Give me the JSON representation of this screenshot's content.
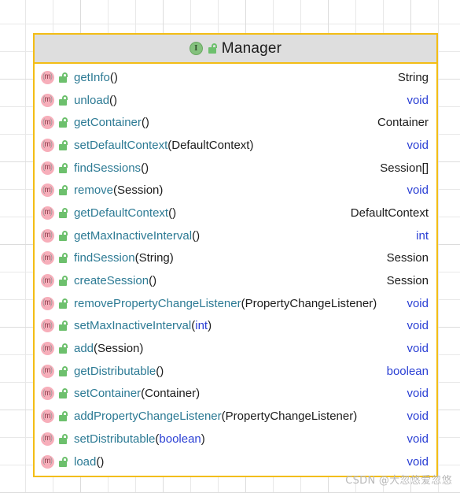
{
  "diagram": {
    "type": "uml-class-diagram",
    "background": "graph-paper-grid",
    "grid_color": "#e8e8e8",
    "box": {
      "border_color": "#f3bd15",
      "header_background": "#dedede",
      "body_background": "#ffffff"
    }
  },
  "class_box": {
    "stereotype_icon": "interface-icon",
    "stereotype_letter": "I",
    "visibility_icon": "public-unlocked-padlock-icon",
    "name": "Manager",
    "members": [
      {
        "icon": "method-icon",
        "visibility_icon": "public-unlocked-padlock-icon",
        "name": "getInfo",
        "params": "",
        "param_primitive": false,
        "return_type": "String",
        "return_primitive": false
      },
      {
        "icon": "method-icon",
        "visibility_icon": "public-unlocked-padlock-icon",
        "name": "unload",
        "params": "",
        "param_primitive": false,
        "return_type": "void",
        "return_primitive": true
      },
      {
        "icon": "method-icon",
        "visibility_icon": "public-unlocked-padlock-icon",
        "name": "getContainer",
        "params": "",
        "param_primitive": false,
        "return_type": "Container",
        "return_primitive": false
      },
      {
        "icon": "method-icon",
        "visibility_icon": "public-unlocked-padlock-icon",
        "name": "setDefaultContext",
        "params": "DefaultContext",
        "param_primitive": false,
        "return_type": "void",
        "return_primitive": true
      },
      {
        "icon": "method-icon",
        "visibility_icon": "public-unlocked-padlock-icon",
        "name": "findSessions",
        "params": "",
        "param_primitive": false,
        "return_type": "Session[]",
        "return_primitive": false
      },
      {
        "icon": "method-icon",
        "visibility_icon": "public-unlocked-padlock-icon",
        "name": "remove",
        "params": "Session",
        "param_primitive": false,
        "return_type": "void",
        "return_primitive": true
      },
      {
        "icon": "method-icon",
        "visibility_icon": "public-unlocked-padlock-icon",
        "name": "getDefaultContext",
        "params": "",
        "param_primitive": false,
        "return_type": "DefaultContext",
        "return_primitive": false
      },
      {
        "icon": "method-icon",
        "visibility_icon": "public-unlocked-padlock-icon",
        "name": "getMaxInactiveInterval",
        "params": "",
        "param_primitive": false,
        "return_type": "int",
        "return_primitive": true
      },
      {
        "icon": "method-icon",
        "visibility_icon": "public-unlocked-padlock-icon",
        "name": "findSession",
        "params": "String",
        "param_primitive": false,
        "return_type": "Session",
        "return_primitive": false
      },
      {
        "icon": "method-icon",
        "visibility_icon": "public-unlocked-padlock-icon",
        "name": "createSession",
        "params": "",
        "param_primitive": false,
        "return_type": "Session",
        "return_primitive": false
      },
      {
        "icon": "method-icon",
        "visibility_icon": "public-unlocked-padlock-icon",
        "name": "removePropertyChangeListener",
        "params": "PropertyChangeListener",
        "param_primitive": false,
        "return_type": "void",
        "return_primitive": true
      },
      {
        "icon": "method-icon",
        "visibility_icon": "public-unlocked-padlock-icon",
        "name": "setMaxInactiveInterval",
        "params": "int",
        "param_primitive": true,
        "return_type": "void",
        "return_primitive": true
      },
      {
        "icon": "method-icon",
        "visibility_icon": "public-unlocked-padlock-icon",
        "name": "add",
        "params": "Session",
        "param_primitive": false,
        "return_type": "void",
        "return_primitive": true
      },
      {
        "icon": "method-icon",
        "visibility_icon": "public-unlocked-padlock-icon",
        "name": "getDistributable",
        "params": "",
        "param_primitive": false,
        "return_type": "boolean",
        "return_primitive": true
      },
      {
        "icon": "method-icon",
        "visibility_icon": "public-unlocked-padlock-icon",
        "name": "setContainer",
        "params": "Container",
        "param_primitive": false,
        "return_type": "void",
        "return_primitive": true
      },
      {
        "icon": "method-icon",
        "visibility_icon": "public-unlocked-padlock-icon",
        "name": "addPropertyChangeListener",
        "params": "PropertyChangeListener",
        "param_primitive": false,
        "return_type": "void",
        "return_primitive": true
      },
      {
        "icon": "method-icon",
        "visibility_icon": "public-unlocked-padlock-icon",
        "name": "setDistributable",
        "params": "boolean",
        "param_primitive": true,
        "return_type": "void",
        "return_primitive": true
      },
      {
        "icon": "method-icon",
        "visibility_icon": "public-unlocked-padlock-icon",
        "name": "load",
        "params": "",
        "param_primitive": false,
        "return_type": "void",
        "return_primitive": true
      }
    ]
  },
  "watermark": {
    "text": "CSDN @大忽悠爱忽悠"
  },
  "colors": {
    "border": "#f3bd15",
    "header_bg": "#dedede",
    "method_name": "#2c7a94",
    "primitive_type": "#2a3fd4",
    "class_type": "#1c1c1c",
    "method_icon": "#f7aeba",
    "interface_icon": "#84c17d",
    "lock_icon": "#6dc06d"
  }
}
